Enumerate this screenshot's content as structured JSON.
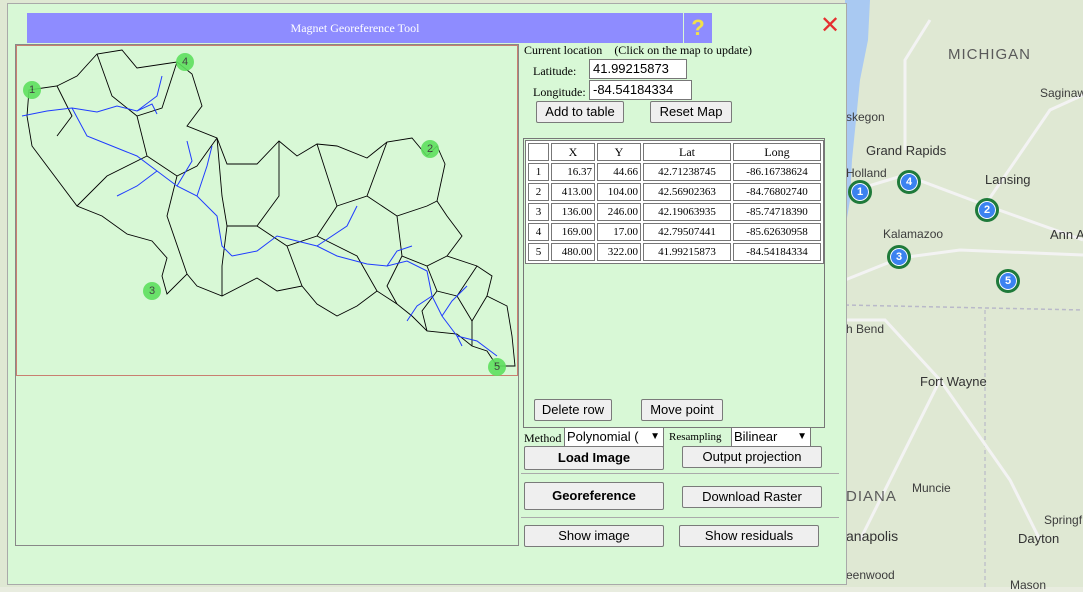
{
  "dialog": {
    "title": "Magnet Georeference Tool",
    "help_glyph": "?",
    "close_glyph": "✕"
  },
  "location": {
    "header": "Current location",
    "hint": "(Click on the map to update)",
    "latitude_label": "Latitude:",
    "latitude_value": "41.99215873",
    "longitude_label": "Longitude:",
    "longitude_value": "-84.54184334"
  },
  "buttons": {
    "add_to_table": "Add to table",
    "reset_map": "Reset Map",
    "delete_row": "Delete row",
    "move_point": "Move point",
    "load_image": "Load Image",
    "output_projection": "Output projection",
    "georeference": "Georeference",
    "download_raster": "Download Raster",
    "show_image": "Show image",
    "show_residuals": "Show residuals"
  },
  "options": {
    "method_label": "Method",
    "method_value": "Polynomial (",
    "resampling_label": "Resampling",
    "resampling_value": "Bilinear"
  },
  "table": {
    "headers": [
      "",
      "X",
      "Y",
      "Lat",
      "Long"
    ],
    "rows": [
      [
        "1",
        "16.37",
        "44.66",
        "42.71238745",
        "-86.16738624"
      ],
      [
        "2",
        "413.00",
        "104.00",
        "42.56902363",
        "-84.76802740"
      ],
      [
        "3",
        "136.00",
        "246.00",
        "42.19063935",
        "-85.74718390"
      ],
      [
        "4",
        "169.00",
        "17.00",
        "42.79507441",
        "-85.62630958"
      ],
      [
        "5",
        "480.00",
        "322.00",
        "41.99215873",
        "-84.54184334"
      ]
    ]
  },
  "image_points": [
    "1",
    "4",
    "2",
    "3",
    "5"
  ],
  "map": {
    "labels": {
      "michigan": "MICHIGAN",
      "saginaw": "Saginaw",
      "muskegon": "skegon",
      "grand_rapids": "Grand Rapids",
      "holland": "Holland",
      "lansing": "Lansing",
      "kalamazoo": "Kalamazoo",
      "ann_arbor": "Ann A",
      "south_bend": "h Bend",
      "fort_wayne": "Fort Wayne",
      "indiana": "DIANA",
      "muncie": "Muncie",
      "indianapolis": "anapolis",
      "springfield": "Springf",
      "dayton": "Dayton",
      "greenwood": "eenwood",
      "mason": "Mason"
    },
    "markers": [
      "1",
      "4",
      "2",
      "3",
      "5"
    ],
    "water_color": "#a9c9f2",
    "land_color": "#dfe8d3",
    "marker_fill": "#3b82f0",
    "marker_ring": "#1f7a3a"
  },
  "colors": {
    "dialog_bg": "#d8f8d6",
    "title_bg": "#8e8cff",
    "close_color": "#e53030",
    "river_color": "#1f3cff"
  }
}
